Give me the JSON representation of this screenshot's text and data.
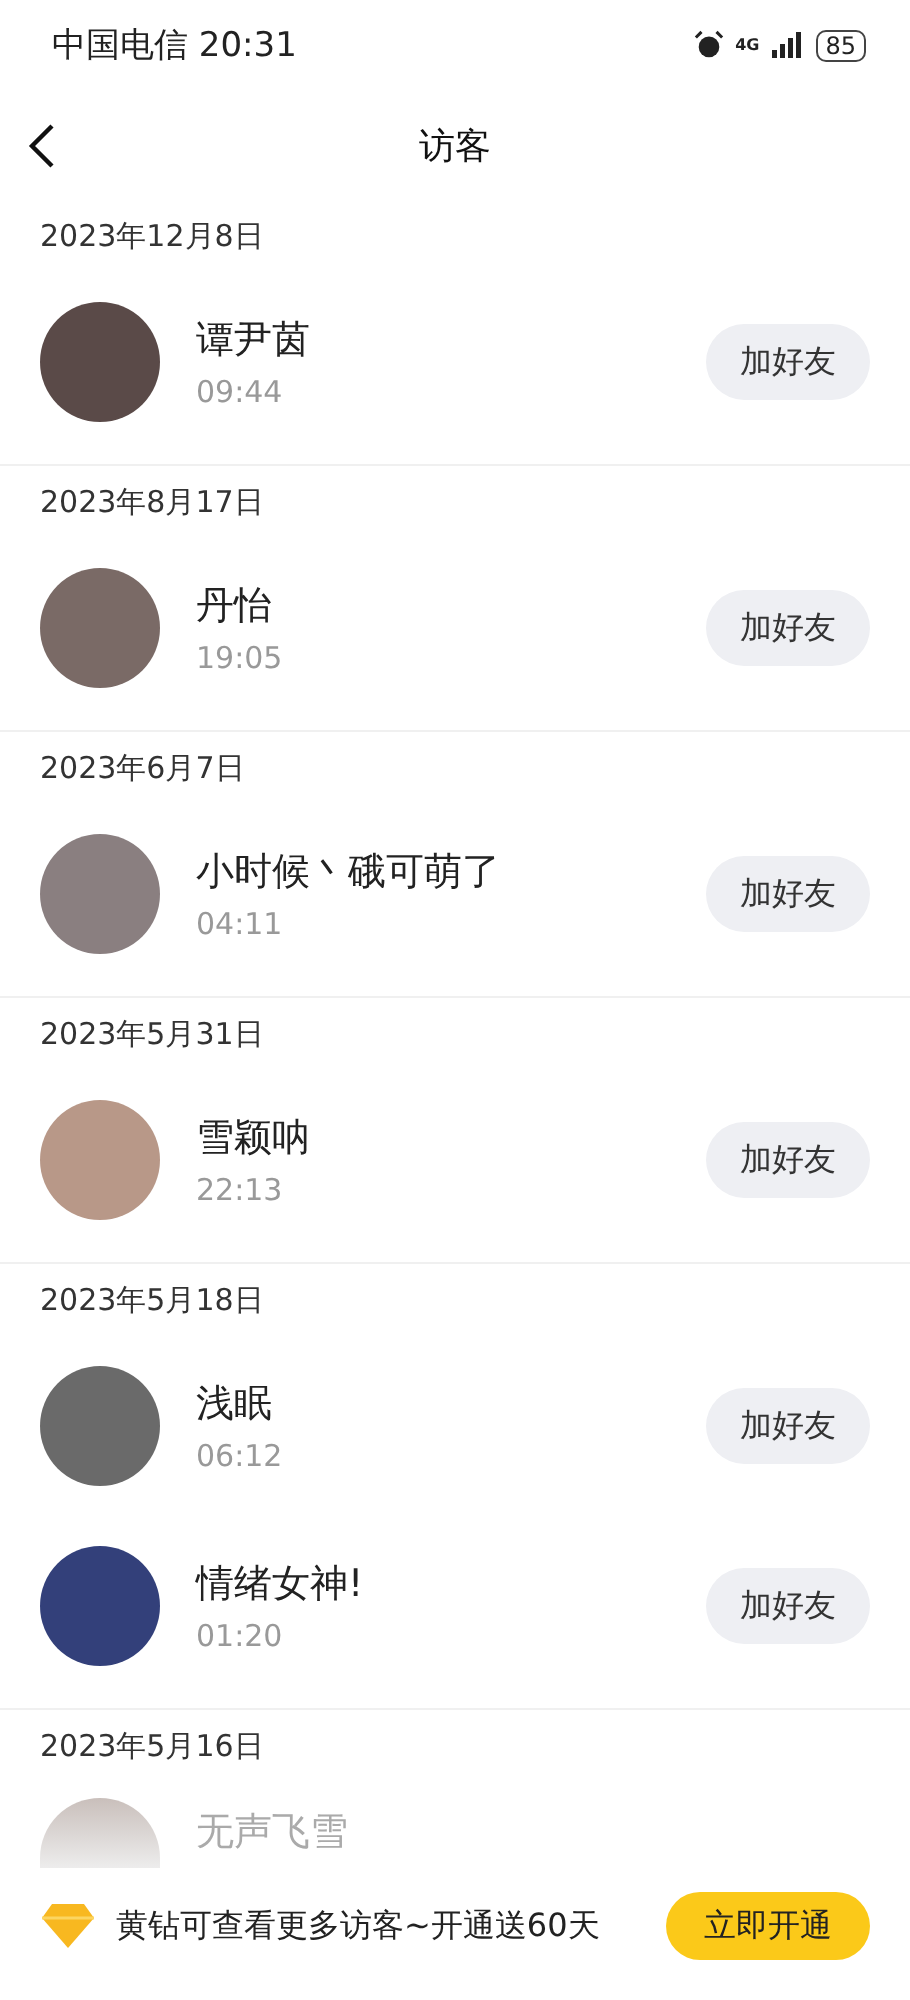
{
  "status_bar": {
    "carrier": "中国电信",
    "time": "20:31",
    "network": "4G",
    "battery": "85"
  },
  "header": {
    "title": "访客"
  },
  "sections": [
    {
      "date": "2023年12月8日",
      "visitors": [
        {
          "name": "谭尹茵",
          "time": "09:44",
          "action": "加好友"
        }
      ]
    },
    {
      "date": "2023年8月17日",
      "visitors": [
        {
          "name": "丹怡",
          "time": "19:05",
          "action": "加好友"
        }
      ]
    },
    {
      "date": "2023年6月7日",
      "visitors": [
        {
          "name": "小时候丶硪可萌了",
          "time": "04:11",
          "action": "加好友"
        }
      ]
    },
    {
      "date": "2023年5月31日",
      "visitors": [
        {
          "name": "雪颖呐",
          "time": "22:13",
          "action": "加好友"
        }
      ]
    },
    {
      "date": "2023年5月18日",
      "visitors": [
        {
          "name": "浅眠",
          "time": "06:12",
          "action": "加好友"
        },
        {
          "name": "情绪女神!",
          "time": "01:20",
          "action": "加好友"
        }
      ]
    },
    {
      "date": "2023年5月16日",
      "visitors": [
        {
          "name": "无声飞雪"
        }
      ]
    }
  ],
  "promo_banner": {
    "text": "黄钻可查看更多访客~开通送60天",
    "button": "立即开通"
  }
}
